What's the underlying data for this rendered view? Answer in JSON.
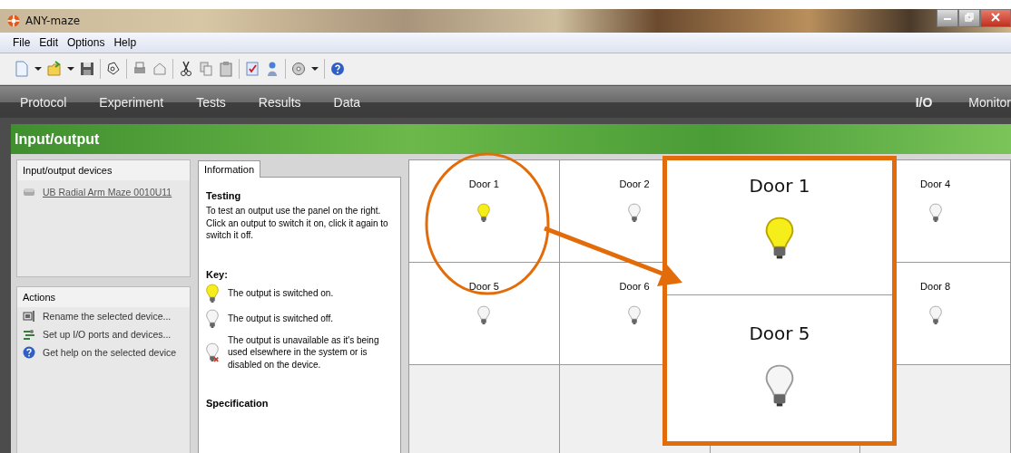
{
  "window": {
    "title": "ANY-maze"
  },
  "menu": [
    "File",
    "Edit",
    "Options",
    "Help"
  ],
  "nav": {
    "left": [
      {
        "label": "Protocol"
      },
      {
        "label": "Experiment"
      },
      {
        "label": "Tests"
      },
      {
        "label": "Results"
      },
      {
        "label": "Data"
      }
    ],
    "right": [
      {
        "label": "I/O"
      },
      {
        "label": "Monitor"
      }
    ]
  },
  "page_title": "Input/output",
  "devices": {
    "title": "Input/output devices",
    "items": [
      "UB Radial Arm Maze 0010U11"
    ]
  },
  "actions": {
    "title": "Actions",
    "items": [
      {
        "kind": "rename",
        "label": "Rename the selected device..."
      },
      {
        "kind": "setup",
        "label": "Set up I/O ports and devices..."
      },
      {
        "kind": "help",
        "label": "Get help on the selected device"
      }
    ]
  },
  "info": {
    "tab": "Information",
    "testing_title": "Testing",
    "testing_text": "To test an output use the panel on the right. Click an output to switch it on, click it again to switch it off.",
    "key_title": "Key:",
    "key": [
      {
        "kind": "on",
        "text": "The output is switched on."
      },
      {
        "kind": "off",
        "text": "The output is switched off."
      },
      {
        "kind": "unavailable",
        "text": "The output is unavailable as it's being used elsewhere in the system or is disabled on the device."
      }
    ],
    "specification_title": "Specification"
  },
  "outputs": [
    {
      "kind": "door",
      "label": "Door 1",
      "on": true
    },
    {
      "kind": "door",
      "label": "Door 2",
      "on": false
    },
    {
      "kind": "blank"
    },
    {
      "kind": "door",
      "label": "Door 4",
      "on": false
    },
    {
      "kind": "door",
      "label": "Door 5",
      "on": false
    },
    {
      "kind": "door",
      "label": "Door 6",
      "on": false
    },
    {
      "kind": "blank"
    },
    {
      "kind": "door",
      "label": "Door 8",
      "on": false
    },
    {
      "kind": "blank"
    },
    {
      "kind": "blank"
    },
    {
      "kind": "blank"
    },
    {
      "kind": "blank"
    }
  ],
  "zoom_inset": [
    {
      "label": "Door 1",
      "on": true
    },
    {
      "label": "Door 5",
      "on": false
    }
  ]
}
